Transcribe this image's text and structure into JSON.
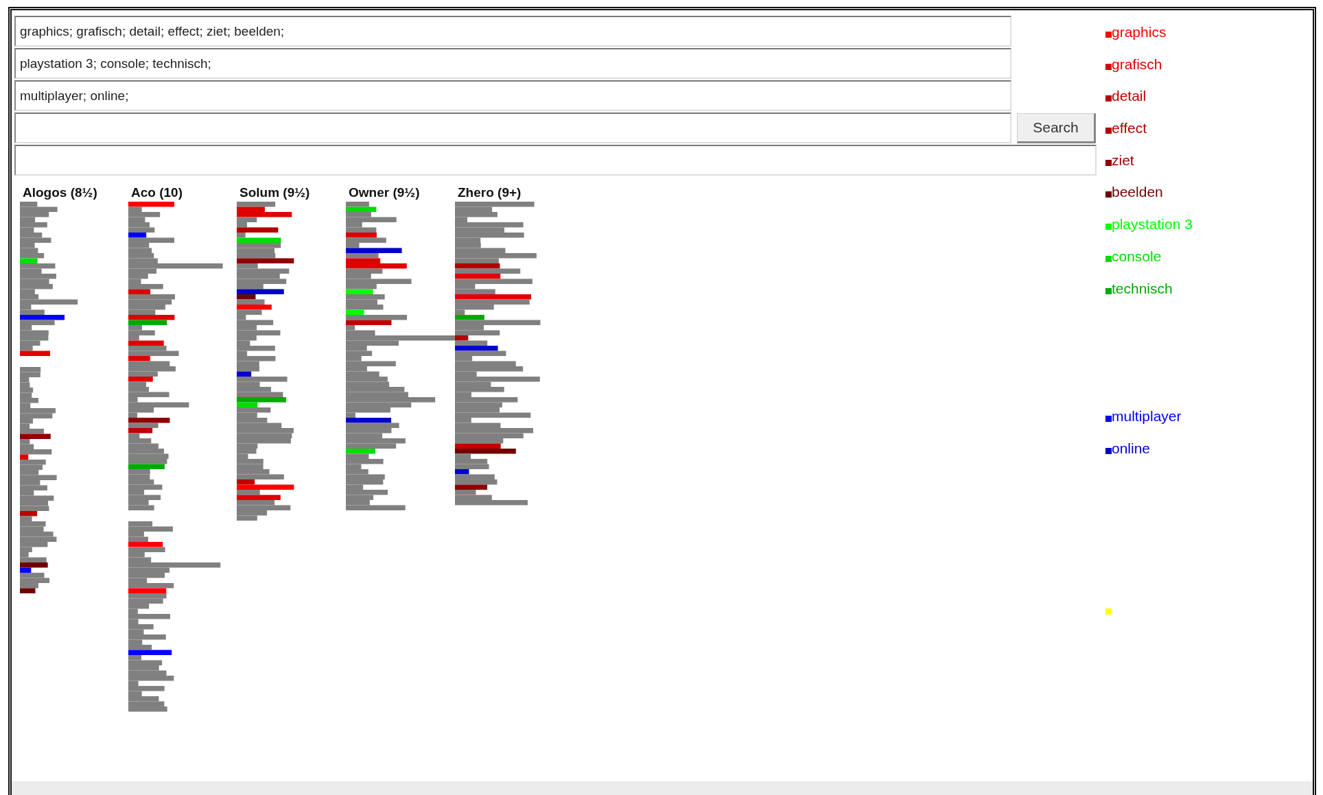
{
  "query_fields": [
    {
      "value": "graphics; grafisch; detail; effect; ziet; beelden;"
    },
    {
      "value": "playstation 3; console; technisch;"
    },
    {
      "value": "multiplayer; online;"
    }
  ],
  "search_button": {
    "label": "Search"
  },
  "columns": [
    {
      "heading": "Alogos (8½)"
    },
    {
      "heading": "Aco (10)"
    },
    {
      "heading": "Solum (9½)"
    },
    {
      "heading": "Owner (9½)"
    },
    {
      "heading": "Zhero (9+)"
    }
  ],
  "legend_groups": [
    [
      {
        "label": "graphics",
        "color": "#ff0000"
      },
      {
        "label": "grafisch",
        "color": "#e00000"
      },
      {
        "label": "detail",
        "color": "#c00000"
      },
      {
        "label": "effect",
        "color": "#b00000"
      },
      {
        "label": "ziet",
        "color": "#900000"
      },
      {
        "label": "beelden",
        "color": "#700000"
      }
    ],
    [
      {
        "label": "playstation 3",
        "color": "#00ff00"
      },
      {
        "label": "console",
        "color": "#00dd00"
      },
      {
        "label": "technisch",
        "color": "#00aa00"
      }
    ],
    [
      {
        "label": "multiplayer",
        "color": "#0000ff"
      },
      {
        "label": "online",
        "color": "#0000cc"
      }
    ],
    [
      {
        "color": "#ffff00"
      }
    ]
  ]
}
